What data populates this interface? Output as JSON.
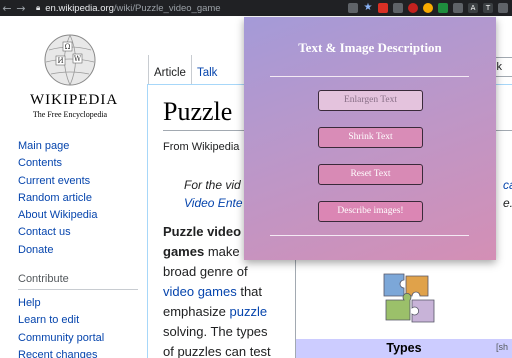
{
  "browser": {
    "url_domain": "en.wikipedia.org",
    "url_path": "/wiki/Puzzle_video_game",
    "back_icon": "back-arrow-icon",
    "forward_icon": "forward-arrow-icon"
  },
  "wikipedia": {
    "wordmark": "Wikipedia",
    "tagline": "The Free Encyclopedia",
    "tabs": [
      "Article",
      "Talk"
    ],
    "search_partial": "ik",
    "sidebar_links": [
      "Main page",
      "Contents",
      "Current events",
      "Random article",
      "About Wikipedia",
      "Contact us",
      "Donate"
    ],
    "contribute_heading": "Contribute",
    "contribute_links": [
      "Help",
      "Learn to edit",
      "Community portal",
      "Recent changes"
    ],
    "title": "Puzzle",
    "from_line": "From Wikipedia",
    "hatnote_line1": "For the vid",
    "hatnote_line2": "Video Ente",
    "hatnote_right_line1": "ca",
    "hatnote_right_line2": "e.",
    "body": {
      "line1_bold": "Puzzle video",
      "line2_bold": "games",
      "line2_rest": " make u",
      "line3": "broad genre of",
      "line4_link": "video games",
      "line4_rest": " that",
      "line5_pre": "emphasize ",
      "line5_link": "puzzle",
      "line6": "solving. The types",
      "line7": "of puzzles can test"
    },
    "infobox_heading": "Types",
    "infobox_show": "[sh"
  },
  "popup": {
    "title": "Text & Image Description",
    "buttons": {
      "enlarge": "Enlargen Text",
      "shrink": "Shrink Text",
      "reset": "Reset Text",
      "describe": "Describe images!"
    }
  },
  "colors": {
    "popup_gradient_start": "#a49ad8",
    "popup_gradient_end": "#d48fb5",
    "link": "#0645ad",
    "infobox_header": "#ccccff"
  }
}
